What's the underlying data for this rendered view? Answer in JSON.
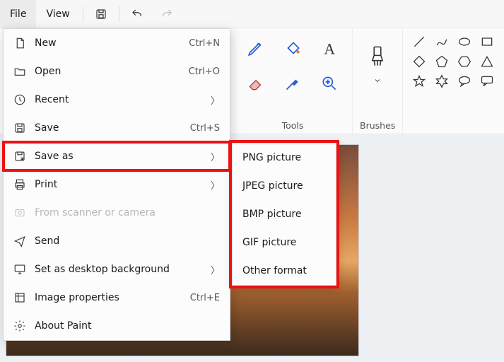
{
  "menubar": {
    "file": "File",
    "view": "View"
  },
  "ribbon": {
    "tools_label": "Tools",
    "brushes_label": "Brushes"
  },
  "file_menu": {
    "new": {
      "label": "New",
      "accel": "Ctrl+N"
    },
    "open": {
      "label": "Open",
      "accel": "Ctrl+O"
    },
    "recent": {
      "label": "Recent"
    },
    "save": {
      "label": "Save",
      "accel": "Ctrl+S"
    },
    "saveas": {
      "label": "Save as"
    },
    "print": {
      "label": "Print"
    },
    "scanner": {
      "label": "From scanner or camera"
    },
    "send": {
      "label": "Send"
    },
    "setbg": {
      "label": "Set as desktop background"
    },
    "props": {
      "label": "Image properties",
      "accel": "Ctrl+E"
    },
    "about": {
      "label": "About Paint"
    }
  },
  "saveas_menu": {
    "png": "PNG picture",
    "jpeg": "JPEG picture",
    "bmp": "BMP picture",
    "gif": "GIF picture",
    "other": "Other format"
  }
}
